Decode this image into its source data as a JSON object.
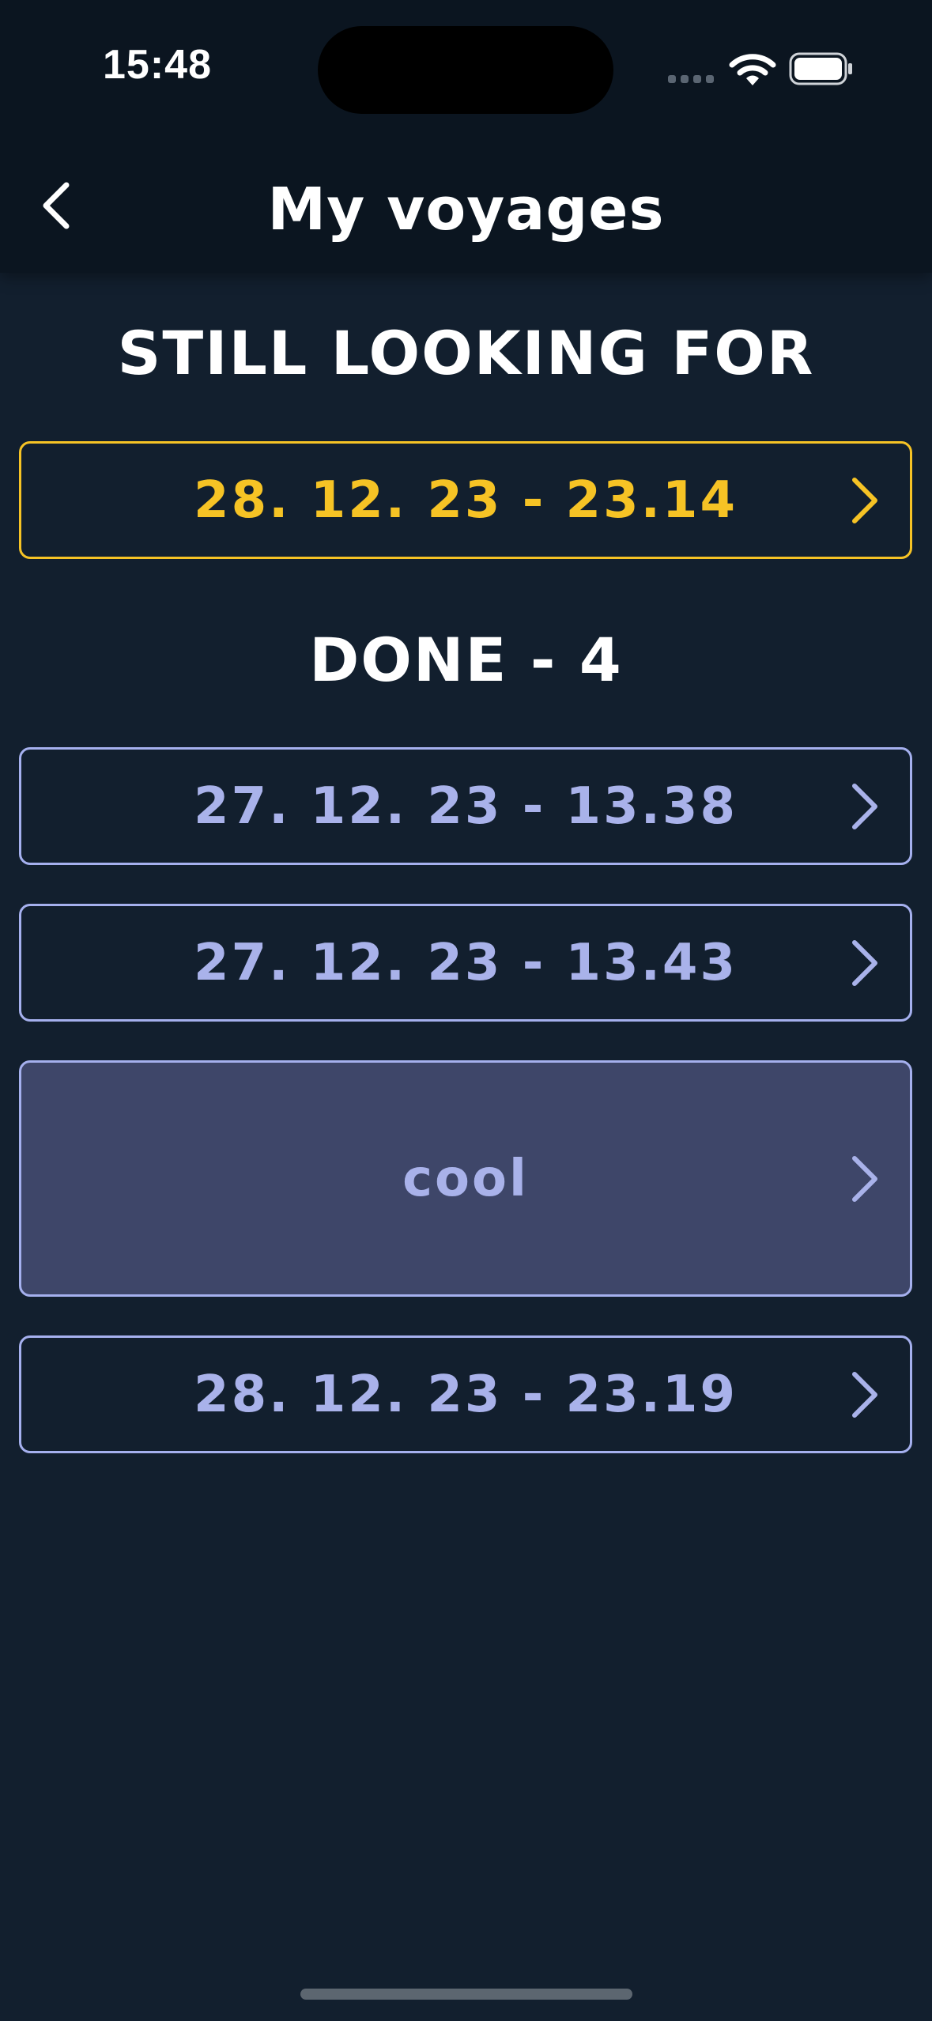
{
  "status_bar": {
    "time": "15:48",
    "icons": [
      "signal-icon",
      "wifi-icon",
      "battery-icon"
    ]
  },
  "header": {
    "title": "My voyages",
    "back_icon": "chevron-left-icon"
  },
  "sections": {
    "still_looking": {
      "title": "STILL LOOKING FOR",
      "items": [
        {
          "label": "28. 12. 23 - 23.14"
        }
      ]
    },
    "done": {
      "title": "DONE - 4",
      "items": [
        {
          "label": "27. 12. 23 - 13.38"
        },
        {
          "label": "27. 12. 23 - 13.43"
        },
        {
          "label": "cool"
        },
        {
          "label": "28. 12. 23 - 23.19"
        }
      ]
    }
  },
  "colors": {
    "background": "#121f2e",
    "header": "#0b1520",
    "accent_active": "#f6c325",
    "accent_done": "#a9b2ea",
    "highlight_row": "#3e4669"
  }
}
